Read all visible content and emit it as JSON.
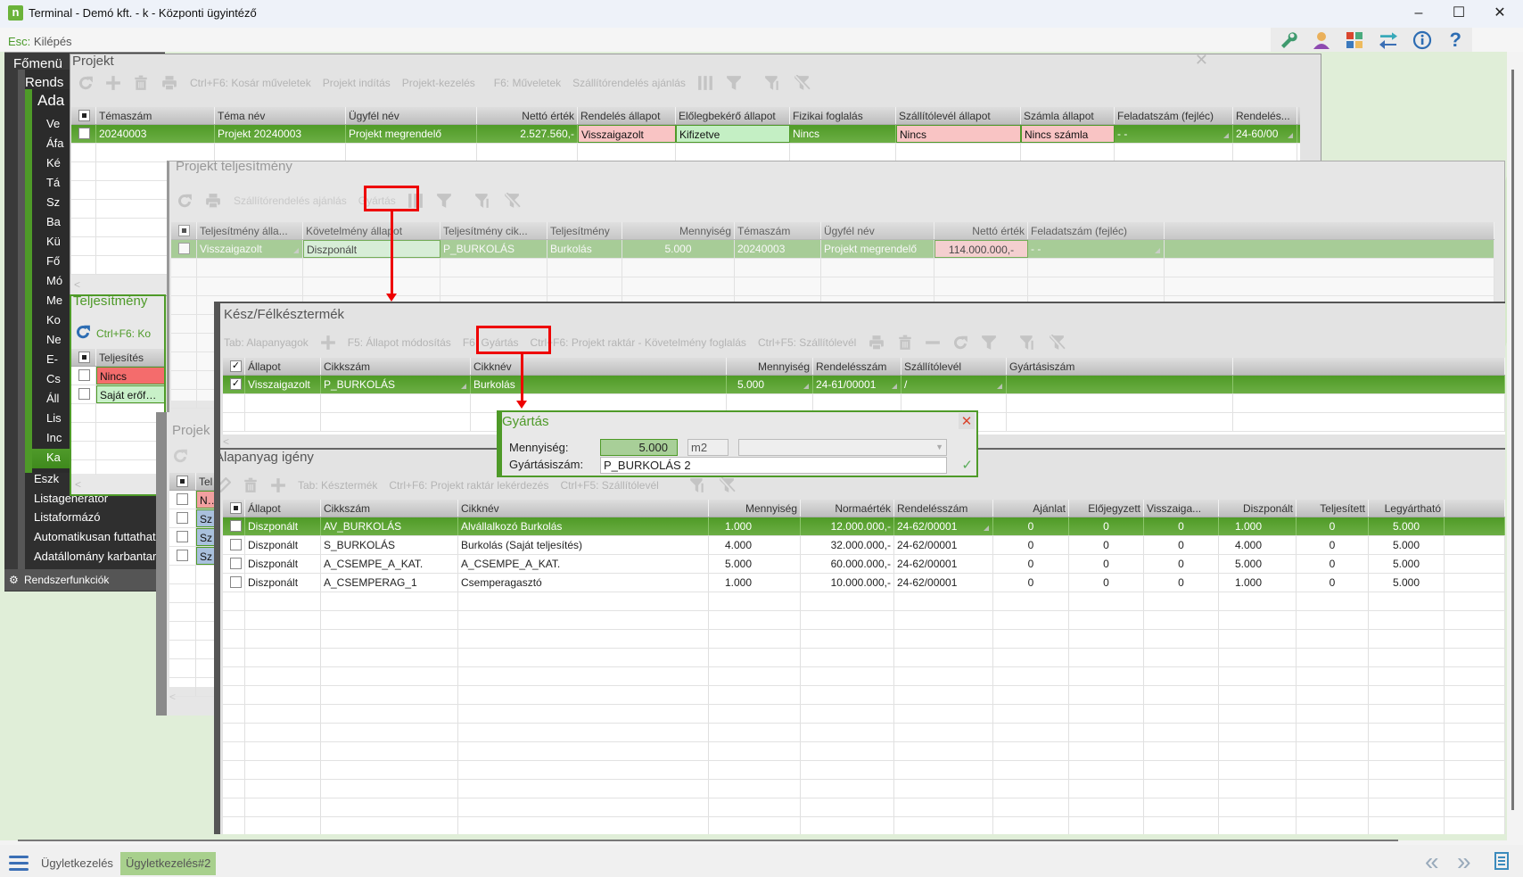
{
  "window": {
    "title": "Terminal - Demó kft. - k - Központi ügyintéző",
    "app_icon": "n",
    "minimize": "–",
    "maximize": "☐",
    "close": "✕"
  },
  "escbar": {
    "key": "Esc:",
    "label": "Kilépés"
  },
  "top_icons": [
    "wrench-icon",
    "user-icon",
    "tiles-icon",
    "swap-icon",
    "info-icon",
    "help-icon"
  ],
  "sidebar": {
    "main": "Főmenü",
    "sub": "Rends",
    "section": "Ada",
    "items": [
      "Ve",
      "Áfa",
      "Ké",
      "Tá",
      "Sz",
      "Ba",
      "Kü",
      "Fő",
      "Mó",
      "Me",
      "Ko",
      "Ne",
      "E-",
      "Cs",
      "Áll",
      "Lis",
      "Inc",
      "Ka"
    ],
    "lower": [
      "Eszk",
      "Listagenerátor",
      "Listaformázó",
      "Automatikusan futtathat",
      "Adatállomány karbantart"
    ],
    "footer": "Rendszerfunkciók"
  },
  "projekt": {
    "title": "Projekt",
    "toolbar": [
      "Ctrl+F6: Kosár műveletek",
      "Projekt indítás",
      "Projekt-kezelés",
      "F6: Műveletek",
      "Szállítórendelés ajánlás"
    ],
    "columns": [
      "",
      "Témaszám",
      "Téma név",
      "Ügyfél név",
      "Nettó érték",
      "Rendelés állapot",
      "Előlegbekérő állapot",
      "Fizikai foglalás",
      "Szállítólevél állapot",
      "Számla állapot",
      "Feladatszám (fejléc)",
      "Rendelés..."
    ],
    "rows": [
      {
        "selected": true,
        "cells": [
          "",
          "20240003",
          "Projekt 20240003",
          "Projekt megrendelő",
          "2.527.560,-",
          "Visszaigazolt",
          "Kifizetve",
          "Nincs",
          "Nincs",
          "Nincs számla",
          "-   -",
          "24-60/00"
        ],
        "cell_colors": {
          "5": "#f9c4c4",
          "6": "#c4efc4",
          "8": "#f9c4c4",
          "9": "#f9c4c4"
        }
      }
    ]
  },
  "teljesitmeny": {
    "title": "Teljesítmény",
    "toolbar": "Ctrl+F6: Ko",
    "columns": [
      "",
      "Teljesítés"
    ],
    "rows": [
      {
        "cells": [
          "",
          "Nincs"
        ],
        "cell_colors": {
          "1": "#f46c6c"
        }
      },
      {
        "cells": [
          "",
          "Saját erőforrá"
        ],
        "cell_colors": {
          "1": "#c8f0c8"
        }
      }
    ]
  },
  "projekt_teljesitmeny": {
    "title": "Projekt teljesítmény",
    "toolbar": [
      "Szállítórendelés ajánlás",
      "Gyártás"
    ],
    "columns": [
      "",
      "Teljesítmény álla...",
      "Követelmény állapot",
      "Teljesítmény cik...",
      "Teljesítmény",
      "Mennyiség",
      "Témaszám",
      "Ügyfél név",
      "Nettó érték",
      "Feladatszám (fejléc)",
      ""
    ],
    "rows": [
      {
        "soft": true,
        "cells": [
          "",
          "Visszaigazolt",
          "Diszponált",
          "P_BURKOLÁS",
          "Burkolás",
          "5.000",
          "20240003",
          "Projekt megrendelő",
          "114.000.000,-",
          "-   -",
          ""
        ],
        "cell_colors": {
          "2": "#d3f0d3",
          "8": "#f9c8c8"
        }
      }
    ]
  },
  "projekt_lower": {
    "title": "Projek",
    "columns": [
      "",
      "Tel"
    ],
    "rows": [
      {
        "cells": [
          "",
          "Nin"
        ],
        "cell_colors": {
          "1": "#f2a0a0"
        }
      },
      {
        "cells": [
          "",
          "Sz"
        ],
        "cell_colors": {
          "1": "#a9c0dd"
        }
      },
      {
        "cells": [
          "",
          "Sz"
        ],
        "cell_colors": {
          "1": "#a9c0dd"
        }
      },
      {
        "cells": [
          "",
          "Sz"
        ],
        "cell_colors": {
          "1": "#a9c0dd"
        }
      }
    ]
  },
  "kesz": {
    "title": "Kész/Félkésztermék",
    "toolbar": [
      "Tab: Alapanyagok",
      "F5: Állapot módosítás",
      "F6: Gyártás",
      "Ctrl+F6: Projekt raktár - Követelmény foglalás",
      "Ctrl+F5: Szállítólevél"
    ],
    "columns": [
      "✓",
      "Állapot",
      "Cikkszám",
      "Cikknév",
      "Mennyiség",
      "Rendelésszám",
      "Szállítólevél",
      "Gyártásiszám",
      ""
    ],
    "rows": [
      {
        "selected": true,
        "cells": [
          "✓",
          "Visszaigazolt",
          "P_BURKOLÁS",
          "Burkolás",
          "5.000",
          "24-61/00001",
          "/",
          "",
          ""
        ]
      }
    ]
  },
  "alapanyag": {
    "title": "Alapanyag igény",
    "toolbar": [
      "Tab: Késztermék",
      "Ctrl+F6: Projekt raktár lekérdezés",
      "Ctrl+F5: Szállítólevél"
    ],
    "columns": [
      "",
      "Állapot",
      "Cikkszám",
      "Cikknév",
      "Mennyiség",
      "Normaérték",
      "Rendelésszám",
      "Ajánlat",
      "Előjegyzett",
      "Visszaiga...",
      "Diszponált",
      "Teljesített",
      "Legyártható",
      ""
    ],
    "rows": [
      {
        "selected": true,
        "cells": [
          "",
          "Diszponált",
          "AV_BURKOLÁS",
          "Alvállalkozó Burkolás",
          "1.000",
          "12.000.000,-",
          "24-62/00001",
          "0",
          "0",
          "0",
          "1.000",
          "0",
          "5.000",
          ""
        ]
      },
      {
        "cells": [
          "",
          "Diszponált",
          "S_BURKOLÁS",
          "Burkolás (Saját teljesítés)",
          "4.000",
          "32.000.000,-",
          "24-62/00001",
          "0",
          "0",
          "0",
          "4.000",
          "0",
          "5.000",
          ""
        ]
      },
      {
        "cells": [
          "",
          "Diszponált",
          "A_CSEMPE_A_KAT.",
          "A_CSEMPE_A_KAT.",
          "5.000",
          "60.000.000,-",
          "24-62/00001",
          "0",
          "0",
          "0",
          "5.000",
          "0",
          "5.000",
          ""
        ]
      },
      {
        "cells": [
          "",
          "Diszponált",
          "A_CSEMPERAG_1",
          "Csemperagasztó",
          "1.000",
          "10.000.000,-",
          "24-62/00001",
          "0",
          "0",
          "0",
          "1.000",
          "0",
          "5.000",
          ""
        ]
      }
    ]
  },
  "dialog": {
    "title": "Gyártás",
    "quantity_label": "Mennyiség:",
    "quantity_value": "5.000",
    "unit": "m2",
    "serial_label": "Gyártásiszám:",
    "serial_value": "P_BURKOLÁS 2",
    "close": "✕",
    "ok": "✓"
  },
  "taskbar": {
    "tabs": [
      "Ügyletkezelés",
      "Ügyletkezelés#2"
    ],
    "active_tab": 1,
    "prev": "«",
    "next": "»"
  },
  "colors": {
    "accent_green": "#4e9a28",
    "highlight_red": "#e00000"
  }
}
